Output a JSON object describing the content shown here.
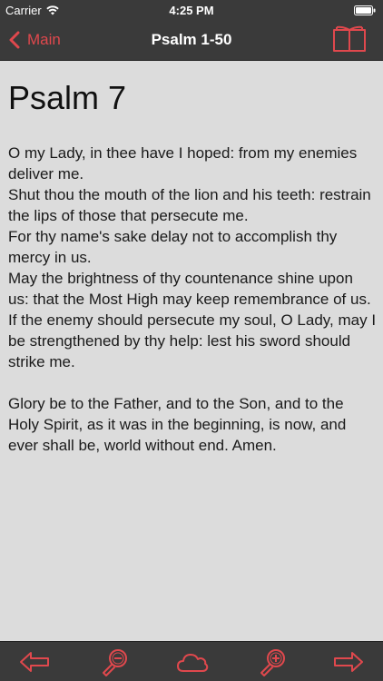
{
  "status_bar": {
    "carrier": "Carrier",
    "time": "4:25 PM"
  },
  "nav": {
    "back_label": "Main",
    "title": "Psalm 1-50"
  },
  "content": {
    "heading": "Psalm 7",
    "verses": [
      "O my Lady, in thee have I hoped: from my enemies deliver me.",
      "Shut thou the mouth of the lion and his teeth: restrain the lips of those that persecute me.",
      "For thy name's sake delay not to accomplish thy mercy in us.",
      "May the brightness of thy countenance shine upon us: that the Most High may keep remembrance of us.",
      "If the enemy should persecute my soul, O Lady, may I be strengthened by thy help: lest his sword should strike me."
    ],
    "doxology": "Glory be to the Father, and to the Son, and to the Holy Spirit, as it was in the beginning, is now, and ever shall be, world without end. Amen."
  },
  "toolbar": {
    "icons": [
      "arrow-left-icon",
      "zoom-out-icon",
      "cloud-icon",
      "zoom-in-icon",
      "arrow-right-icon"
    ]
  },
  "colors": {
    "accent": "#e0484d",
    "bar_background": "#3a3a3a",
    "content_background": "#dcdcdc"
  }
}
